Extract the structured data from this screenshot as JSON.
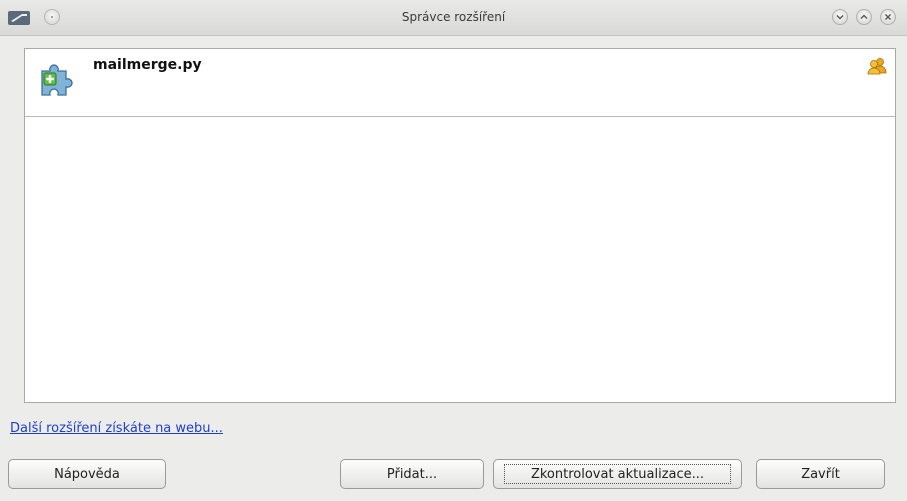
{
  "window": {
    "title": "Správce rozšíření",
    "icons": {
      "app": "app-icon",
      "sticky": "pin-icon",
      "minimize": "minimize-icon",
      "maximize": "maximize-icon",
      "close": "close-icon"
    }
  },
  "extensions": [
    {
      "name": "mailmerge.py",
      "icon": "extension-puzzle-icon",
      "badge": "shared-users-icon"
    }
  ],
  "web_link": "Další rozšíření získáte na webu...",
  "buttons": {
    "help": "Nápověda",
    "add": "Přidat...",
    "check_updates": "Zkontrolovat aktualizace...",
    "close": "Zavřít"
  },
  "colors": {
    "link": "#1f3fcc",
    "list_background": "#ffffff",
    "dialog_background": "#ececeb"
  }
}
